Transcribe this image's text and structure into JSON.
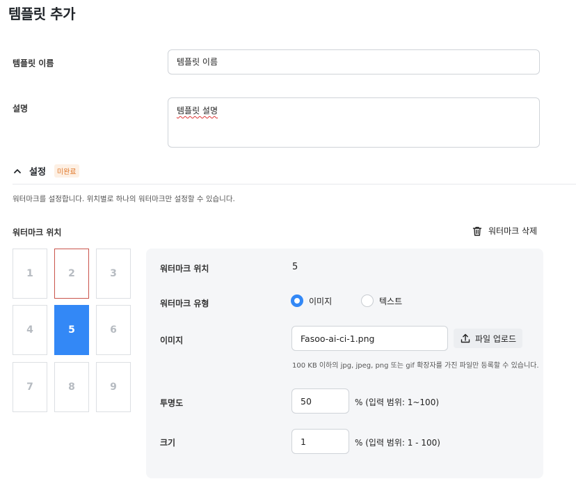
{
  "page": {
    "title": "템플릿 추가"
  },
  "form": {
    "name_label": "템플릿 이름",
    "name_value": "템플릿 이름",
    "desc_label": "설명",
    "desc_value": "템플릿 설명"
  },
  "settings": {
    "title": "설정",
    "badge": "미완료",
    "description": "워터마크를 설정합니다. 위치별로 하나의 워터마크만 설정할 수 있습니다.",
    "position_label": "워터마크 위치",
    "delete_label": "워터마크 삭제",
    "grid": [
      "1",
      "2",
      "3",
      "4",
      "5",
      "6",
      "7",
      "8",
      "9"
    ],
    "selected": "5"
  },
  "panel": {
    "position_label": "워터마크 위치",
    "position_value": "5",
    "type_label": "워터마크 유형",
    "type_options": [
      "이미지",
      "텍스트"
    ],
    "image_label": "이미지",
    "image_value": "Fasoo-ai-ci-1.png",
    "upload_label": "파일 업로드",
    "hint": "100 KB 이하의 jpg, jpeg, png 또는 gif 확장자를 가진 파일만 등록할 수 있습니다.",
    "opacity_label": "투명도",
    "opacity_value": "50",
    "opacity_unit": "% (입력 범위: 1~100)",
    "size_label": "크기",
    "size_value": "1",
    "size_unit": "% (입력 범위: 1 - 100)"
  },
  "colors": {
    "accent": "#3388f6",
    "badge_text": "#e0772a",
    "badge_bg": "#fdf0e4",
    "hover_border": "#c9534a"
  }
}
